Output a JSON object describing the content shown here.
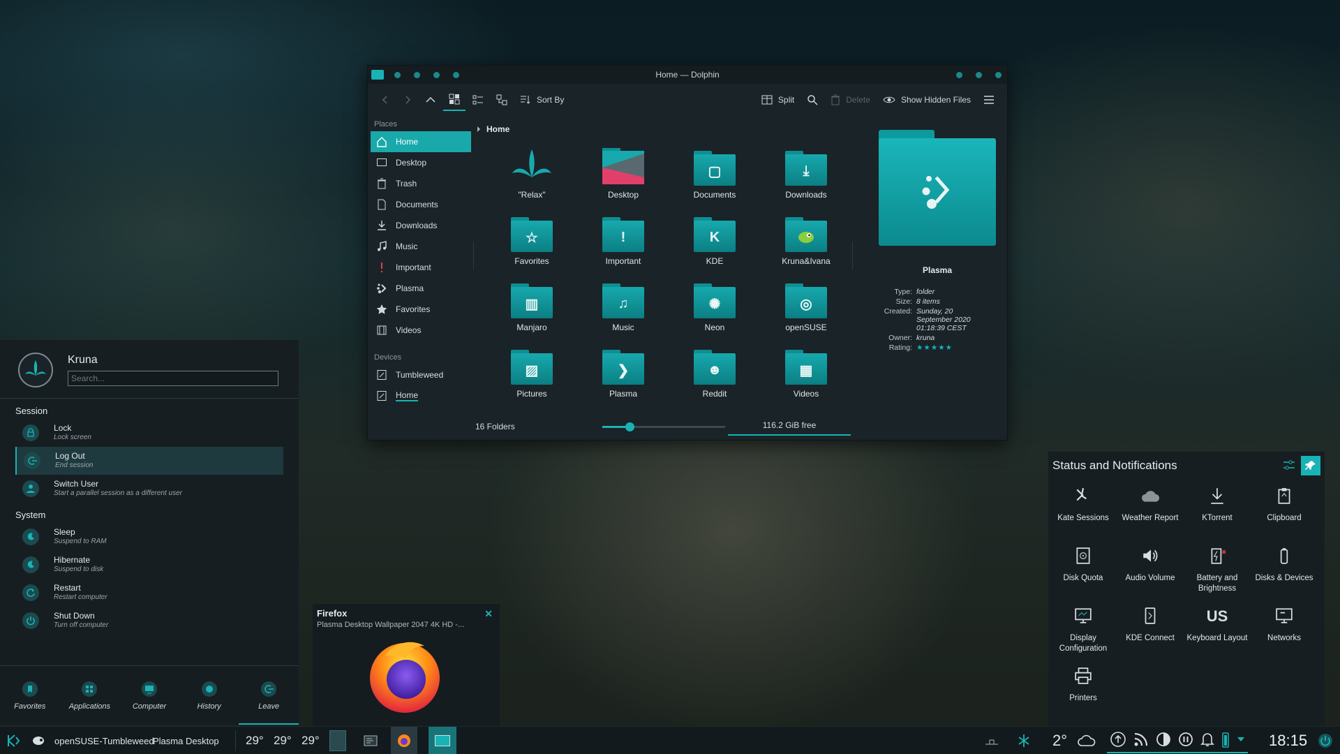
{
  "dolphin": {
    "title": "Home — Dolphin",
    "toolbar": {
      "sort_by": "Sort By",
      "split": "Split",
      "delete": "Delete",
      "show_hidden": "Show Hidden Files"
    },
    "places_header": "Places",
    "places": [
      {
        "label": "Home",
        "icon": "home-icon"
      },
      {
        "label": "Desktop",
        "icon": "desktop-icon"
      },
      {
        "label": "Trash",
        "icon": "trash-icon"
      },
      {
        "label": "Documents",
        "icon": "documents-icon"
      },
      {
        "label": "Downloads",
        "icon": "downloads-icon"
      },
      {
        "label": "Music",
        "icon": "music-icon"
      },
      {
        "label": "Important",
        "icon": "important-icon"
      },
      {
        "label": "Plasma",
        "icon": "plasma-icon"
      },
      {
        "label": "Favorites",
        "icon": "star-icon"
      },
      {
        "label": "Videos",
        "icon": "videos-icon"
      }
    ],
    "devices_header": "Devices",
    "devices": [
      {
        "label": "Tumbleweed",
        "icon": "drive-icon"
      },
      {
        "label": "Home",
        "icon": "drive-icon"
      }
    ],
    "breadcrumb": "Home",
    "files": [
      {
        "label": "\"Relax\"",
        "glyph": ""
      },
      {
        "label": "Desktop",
        "glyph": ""
      },
      {
        "label": "Documents",
        "glyph": "▢"
      },
      {
        "label": "Downloads",
        "glyph": "⤓"
      },
      {
        "label": "Favorites",
        "glyph": "☆"
      },
      {
        "label": "Important",
        "glyph": "!"
      },
      {
        "label": "KDE",
        "glyph": "K"
      },
      {
        "label": "Kruna&Ivana",
        "glyph": ""
      },
      {
        "label": "Manjaro",
        "glyph": "▥"
      },
      {
        "label": "Music",
        "glyph": "♫"
      },
      {
        "label": "Neon",
        "glyph": "✺"
      },
      {
        "label": "openSUSE",
        "glyph": "◎"
      },
      {
        "label": "Pictures",
        "glyph": "▨"
      },
      {
        "label": "Plasma",
        "glyph": "❯"
      },
      {
        "label": "Reddit",
        "glyph": "☻"
      },
      {
        "label": "Videos",
        "glyph": "▦"
      }
    ],
    "preview": {
      "name": "Plasma",
      "type_k": "Type:",
      "type_v": "folder",
      "size_k": "Size:",
      "size_v": "8 items",
      "created_k": "Created:",
      "created_v": "Sunday, 20 September 2020 01:18:39 CEST",
      "owner_k": "Owner:",
      "owner_v": "kruna",
      "rating_k": "Rating:",
      "rating_v": "★★★★★"
    },
    "status_left": "16 Folders",
    "zoom_fraction": 0.22,
    "free_space": "116.2 GiB free"
  },
  "launcher": {
    "user": "Kruna",
    "search_placeholder": "Search...",
    "session_header": "Session",
    "session": [
      {
        "title": "Lock",
        "sub": "Lock screen"
      },
      {
        "title": "Log Out",
        "sub": "End session"
      },
      {
        "title": "Switch User",
        "sub": "Start a parallel session as a different user"
      }
    ],
    "system_header": "System",
    "system": [
      {
        "title": "Sleep",
        "sub": "Suspend to RAM"
      },
      {
        "title": "Hibernate",
        "sub": "Suspend to disk"
      },
      {
        "title": "Restart",
        "sub": "Restart computer"
      },
      {
        "title": "Shut Down",
        "sub": "Turn off computer"
      }
    ],
    "tabs": [
      "Favorites",
      "Applications",
      "Computer",
      "History",
      "Leave"
    ]
  },
  "firefox_tooltip": {
    "title": "Firefox",
    "subtitle": "Plasma Desktop Wallpaper 2047 4K HD -..."
  },
  "status_panel": {
    "title": "Status and Notifications",
    "items": [
      "Kate Sessions",
      "Weather Report",
      "KTorrent",
      "Clipboard",
      "Disk Quota",
      "Audio Volume",
      "Battery and Brightness",
      "Disks & Devices",
      "Display Configuration",
      "KDE Connect",
      "Keyboard Layout",
      "Networks",
      "Printers"
    ],
    "keyboard_layout_code": "US"
  },
  "taskbar": {
    "distro": "openSUSE-Tumbleweed",
    "desktop": "Plasma Desktop",
    "temps": [
      "29°",
      "29°",
      "29°"
    ],
    "weather_temp": "2°",
    "clock": "18:15"
  },
  "colors": {
    "accent": "#19b3b5",
    "folder": "#0b7f83"
  }
}
